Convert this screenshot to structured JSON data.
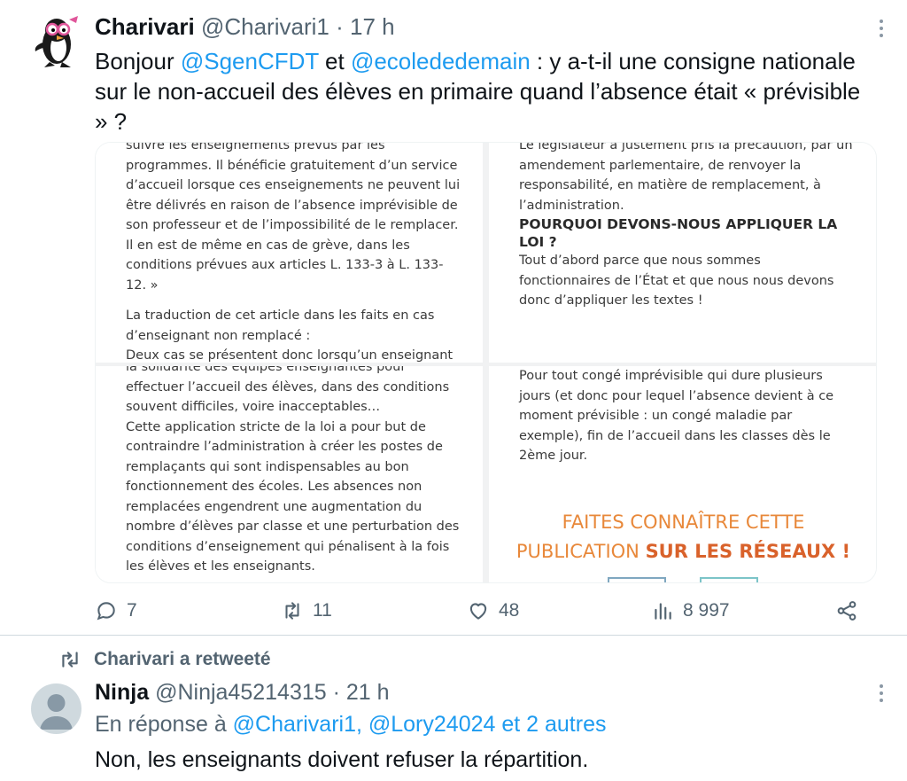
{
  "tweet": {
    "author_name": "Charivari",
    "author_handle": "@Charivari1",
    "separator": "·",
    "time": "17 h",
    "text_before_1": "Bonjour ",
    "mention_1": "@SgenCFDT",
    "text_between": " et ",
    "mention_2": "@ecolededemain",
    "text_after": " : y a-t-il une consigne nationale sur le non-accueil des élèves en primaire quand l’absence était « prévisible » ?",
    "media": {
      "top_left": [
        "suivre les enseignements prévus par les programmes. Il bénéficie gratuitement d’un service d’accueil lorsque ces enseignements ne peuvent lui être délivrés en raison de l’absence imprévisible de son professeur et de l’impossibilité de le remplacer. Il en est de même en cas de grève, dans les conditions prévues aux articles L. 133-3 à L. 133-12. »",
        "La traduction de cet article dans les faits en cas d’enseignant non remplacé :",
        "Deux cas se présentent donc lorsqu’un enseignant"
      ],
      "top_right_para": "Le législateur a justement pris la précaution, par un amendement parlementaire, de renvoyer la responsabilité, en matière de remplacement, à l’administration.",
      "top_right_heading": "POURQUOI DEVONS-NOUS APPLIQUER LA LOI ?",
      "top_right_para2": "Tout d’abord parce que nous sommes fonctionnaires de l’État et que nous nous devons donc d’appliquer les textes !",
      "bottom_left": [
        "la solidarité des équipes enseignantes pour effectuer l’accueil des élèves, dans des conditions souvent difficiles, voire inacceptables…",
        "Cette application stricte de la loi a pour but de contraindre l’administration à créer les postes de remplaçants qui sont indispensables au bon fonctionnement des écoles. Les absences non remplacées engendrent une augmentation du nombre d’élèves par classe et une perturbation des conditions d’enseignement qui pénalisent à la fois les élèves et les enseignants."
      ],
      "bottom_right_para": "Pour tout congé imprévisible qui dure plusieurs jours (et donc pour lequel l’absence devient à ce moment prévisible : un congé maladie par exemple), fin de l’accueil dans les classes dès le 2ème jour.",
      "cta_line1": "FAITES CONNAÎTRE CETTE",
      "cta_line2_prefix": "PUBLICATION ",
      "cta_line2_bold": "SUR LES RÉSEAUX !"
    },
    "stats": {
      "replies": "7",
      "retweets": "11",
      "likes": "48",
      "views": "8 997"
    }
  },
  "retweet_context": {
    "label": "Charivari a retweeté"
  },
  "reply": {
    "author_name": "Ninja",
    "author_handle": "@Ninja45214315",
    "separator": "·",
    "time": "21 h",
    "reply_prefix": "En réponse à ",
    "reply_targets": "@Charivari1, @Lory24024 et 2 autres",
    "text": "Non, les enseignants doivent refuser la répartition."
  },
  "colors": {
    "link": "#1d9bf0",
    "secondary": "#536471",
    "primary": "#0f1419",
    "cta_orange": "#e8883a"
  },
  "icons": [
    "avatar-penguin",
    "more-icon",
    "reply-icon",
    "retweet-icon",
    "like-icon",
    "views-icon",
    "share-icon",
    "default-avatar"
  ]
}
